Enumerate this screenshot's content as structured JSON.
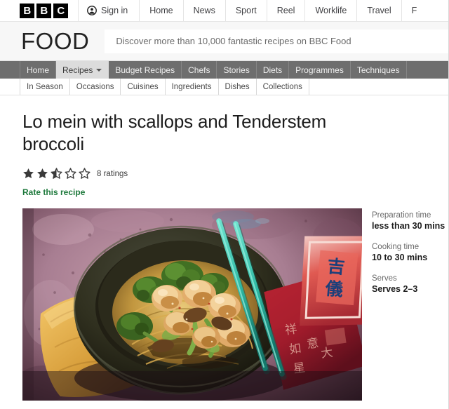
{
  "masthead": {
    "logo_letters": [
      "B",
      "B",
      "C"
    ],
    "signin": {
      "label": "Sign in",
      "icon": "account-circle-icon"
    },
    "links": [
      "Home",
      "News",
      "Sport",
      "Reel",
      "Worklife",
      "Travel",
      "F"
    ]
  },
  "brand": {
    "wordmark": "FOOD",
    "strapline": "Discover more than 10,000 fantastic recipes on BBC Food"
  },
  "primary_nav": {
    "items": [
      {
        "label": "Home",
        "active": false,
        "has_caret": false
      },
      {
        "label": "Recipes",
        "active": true,
        "has_caret": true
      },
      {
        "label": "Budget Recipes",
        "active": false,
        "has_caret": false
      },
      {
        "label": "Chefs",
        "active": false,
        "has_caret": false
      },
      {
        "label": "Stories",
        "active": false,
        "has_caret": false
      },
      {
        "label": "Diets",
        "active": false,
        "has_caret": false
      },
      {
        "label": "Programmes",
        "active": false,
        "has_caret": false
      },
      {
        "label": "Techniques",
        "active": false,
        "has_caret": false
      }
    ]
  },
  "secondary_nav": {
    "items": [
      "In Season",
      "Occasions",
      "Cuisines",
      "Ingredients",
      "Dishes",
      "Collections"
    ]
  },
  "recipe": {
    "title": "Lo mein with scallops and Tenderstem broccoli",
    "rating": {
      "value": 2.5,
      "max": 5,
      "stars": [
        "full",
        "full",
        "half",
        "empty",
        "empty"
      ],
      "count_label": "8 ratings"
    },
    "rate_link_label": "Rate this recipe",
    "image_alt": "Lo mein with scallops and Tenderstem broccoli in a dark bowl with teal chopsticks and red envelopes",
    "meta": [
      {
        "label": "Preparation time",
        "value": "less than 30 mins"
      },
      {
        "label": "Cooking time",
        "value": "10 to 30 mins"
      },
      {
        "label": "Serves",
        "value": "Serves 2–3"
      }
    ]
  },
  "colors": {
    "nav_bar": "#6e6e6e",
    "nav_active_bg": "#dcdcdc",
    "brand_bar_bg": "#f7f7f7",
    "link_green": "#1f7a3d",
    "star_fill": "#3a3a3a",
    "text_primary": "#1c1c1c",
    "text_muted": "#6a6a6a"
  }
}
